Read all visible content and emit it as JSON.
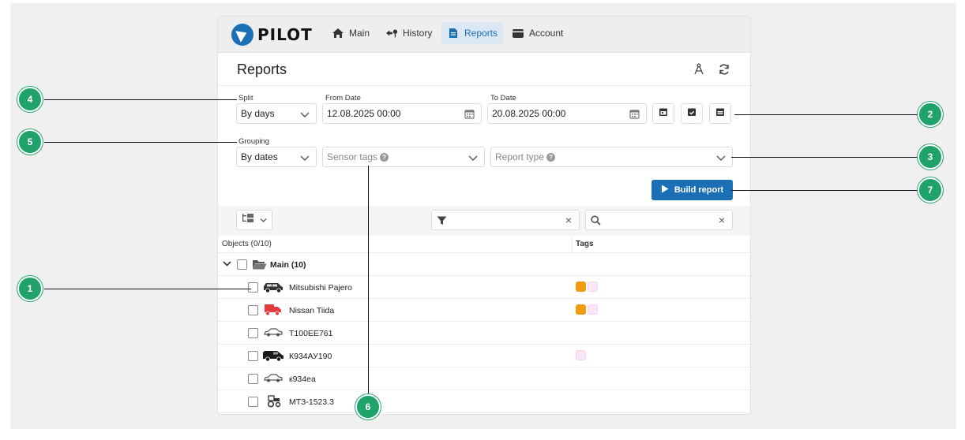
{
  "nav": {
    "logo_text": "PILOT",
    "items": [
      {
        "label": "Main",
        "icon": "home-icon"
      },
      {
        "label": "History",
        "icon": "history-icon"
      },
      {
        "label": "Reports",
        "icon": "report-icon",
        "active": true
      },
      {
        "label": "Account",
        "icon": "wallet-icon"
      }
    ]
  },
  "header": {
    "title": "Reports",
    "icons": [
      "compass-tool-icon",
      "refresh-icon"
    ]
  },
  "form": {
    "split_label": "Split",
    "split_value": "By days",
    "from_label": "From Date",
    "from_value": "12.08.2025 00:00",
    "to_label": "To Date",
    "to_value": "20.08.2025 00:00",
    "grouping_label": "Grouping",
    "grouping_value": "By dates",
    "sensor_tags_placeholder": "Sensor tags",
    "report_type_placeholder": "Report type",
    "build_label": "Build report"
  },
  "table": {
    "objects_header": "Objects (0/10)",
    "tags_header": "Tags",
    "group": {
      "label": "Main (10)"
    },
    "rows": [
      {
        "name": "Mitsubishi Pajero",
        "icon": "suv-icon",
        "tags": [
          "orange",
          "pink"
        ]
      },
      {
        "name": "Nissan Tiida",
        "icon": "truck-icon",
        "tags": [
          "orange",
          "pink"
        ]
      },
      {
        "name": "T100EE761",
        "icon": "car-icon",
        "tags": []
      },
      {
        "name": "К934АУ190",
        "icon": "van-icon",
        "tags": [
          "pink"
        ]
      },
      {
        "name": "к934еа",
        "icon": "car-icon",
        "tags": []
      },
      {
        "name": "МТЗ-1523.3",
        "icon": "tractor-icon",
        "tags": []
      }
    ]
  },
  "callouts": [
    "1",
    "2",
    "3",
    "4",
    "5",
    "6",
    "7"
  ],
  "colors": {
    "accent": "#1b6fb5",
    "callout": "#1fa36a",
    "tag_orange": "#f29c12",
    "tag_pink": "#fbe6f7"
  }
}
